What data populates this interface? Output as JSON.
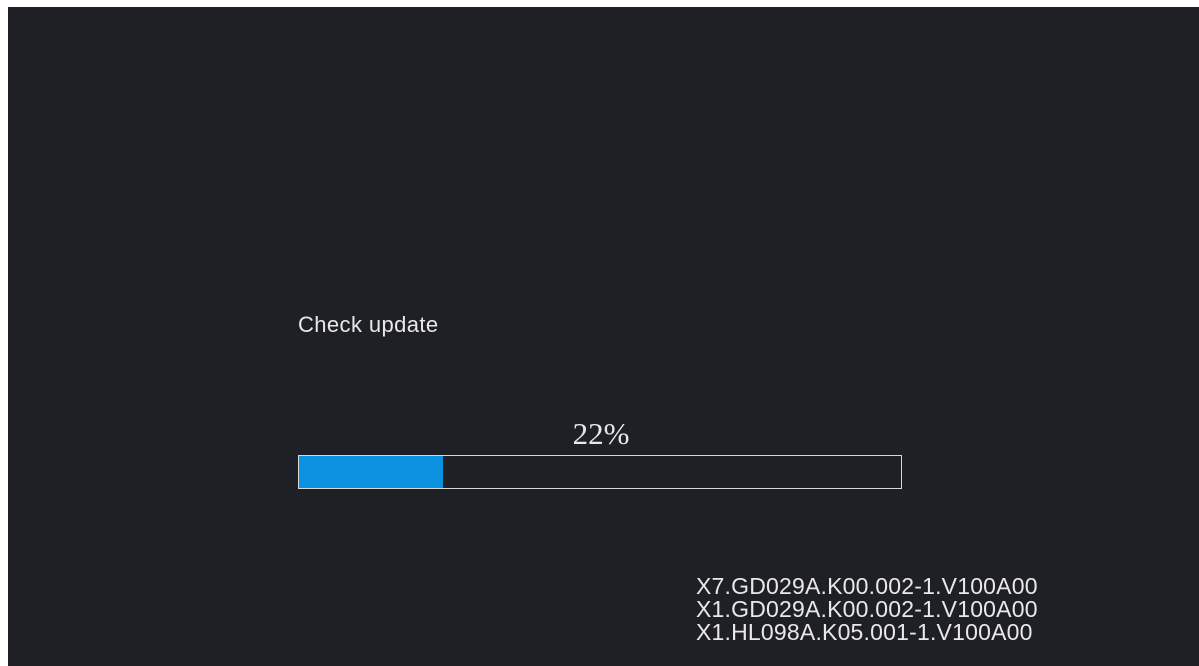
{
  "update": {
    "status_text": "Check update",
    "progress_label": "22%",
    "progress_fraction": 0.24,
    "accent_color": "#0a92e0",
    "background_color": "#1f2025"
  },
  "versions": [
    "X7.GD029A.K00.002-1.V100A00",
    "X1.GD029A.K00.002-1.V100A00",
    "X1.HL098A.K05.001-1.V100A00"
  ]
}
